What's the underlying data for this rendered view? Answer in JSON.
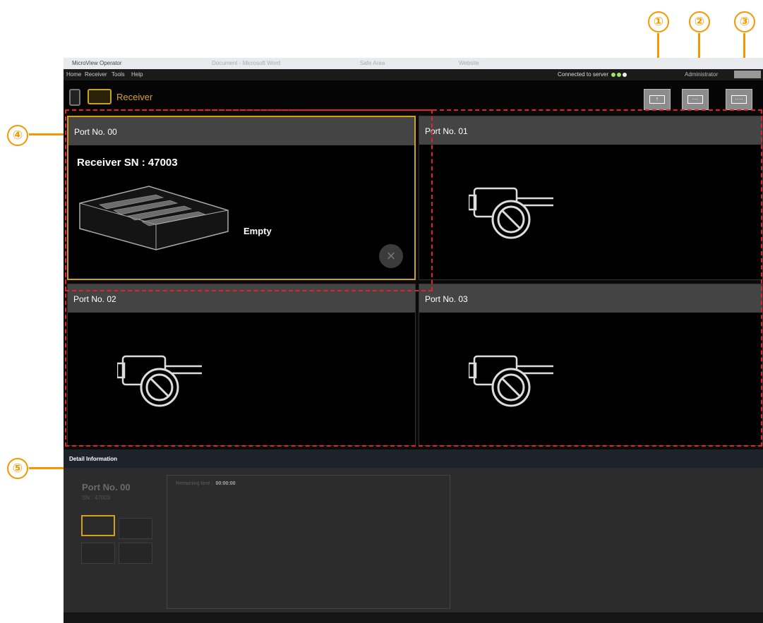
{
  "callouts": [
    "①",
    "②",
    "③",
    "④",
    "⑤"
  ],
  "window": {
    "title": "MicroView Operator",
    "blurred_tabs": [
      "Document - Microsoft Word",
      "Safe Area",
      "Website"
    ]
  },
  "menu": {
    "items": [
      "Home",
      "Receiver",
      "Tools",
      "Help"
    ],
    "connection_status": "Connected to server",
    "user": "Administrator"
  },
  "toolbar": {
    "title": "Receiver",
    "buttons": [
      "upload-button",
      "button-2",
      "button-3"
    ]
  },
  "ports": [
    {
      "label": "Port No. 00",
      "receiver_sn": "Receiver SN : 47003",
      "status": "Empty",
      "connected": true
    },
    {
      "label": "Port No. 01",
      "connected": false
    },
    {
      "label": "Port No. 02",
      "connected": false
    },
    {
      "label": "Port No. 03",
      "connected": false
    }
  ],
  "detail": {
    "header": "Detail Information",
    "port_label": "Port No. 00",
    "sn_label": "SN : 47003",
    "remaining_label": "Remaining time :",
    "remaining_value": "00:00:00"
  },
  "colors": {
    "accent": "#d4a017",
    "callout": "#f39800",
    "dashed": "#e02424"
  }
}
